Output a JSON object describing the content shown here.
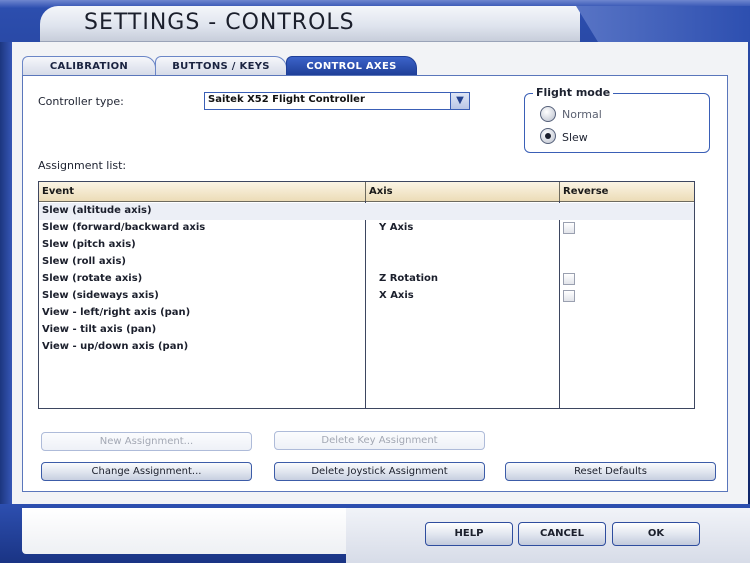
{
  "window": {
    "title": "SETTINGS - CONTROLS"
  },
  "tabs": [
    {
      "label": "CALIBRATION",
      "active": false
    },
    {
      "label": "BUTTONS / KEYS",
      "active": false
    },
    {
      "label": "CONTROL AXES",
      "active": true
    }
  ],
  "controller": {
    "label": "Controller type:",
    "value": "Saitek X52 Flight Controller",
    "dropdown_icon": "chevron-down-icon"
  },
  "flight_mode": {
    "title": "Flight mode",
    "options": [
      {
        "label": "Normal",
        "selected": false
      },
      {
        "label": "Slew",
        "selected": true
      }
    ]
  },
  "assignment_list": {
    "label": "Assignment list:",
    "columns": [
      "Event",
      "Axis",
      "Reverse"
    ],
    "rows": [
      {
        "event": "Slew (altitude axis)",
        "axis": "",
        "reverse": null
      },
      {
        "event": "Slew (forward/backward axis",
        "axis": "Y Axis",
        "reverse": false
      },
      {
        "event": "Slew (pitch axis)",
        "axis": "",
        "reverse": null
      },
      {
        "event": "Slew (roll axis)",
        "axis": "",
        "reverse": null
      },
      {
        "event": "Slew (rotate axis)",
        "axis": "Z Rotation",
        "reverse": false
      },
      {
        "event": "Slew (sideways axis)",
        "axis": "X Axis",
        "reverse": false
      },
      {
        "event": "View - left/right axis (pan)",
        "axis": "",
        "reverse": null
      },
      {
        "event": "View - tilt axis (pan)",
        "axis": "",
        "reverse": null
      },
      {
        "event": "View - up/down axis (pan)",
        "axis": "",
        "reverse": null
      }
    ]
  },
  "buttons": {
    "new_assignment": "New Assignment...",
    "delete_key_assignment": "Delete Key Assignment",
    "change_assignment": "Change Assignment...",
    "delete_joystick_assignment": "Delete Joystick Assignment",
    "reset_defaults": "Reset Defaults"
  },
  "footer": {
    "help": "HELP",
    "cancel": "CANCEL",
    "ok": "OK"
  },
  "colors": {
    "frame_blue": "#2d4fb0",
    "active_tab": "#1f3f98",
    "header_beige": "#ecdcb7",
    "panel_white": "#ffffff"
  }
}
